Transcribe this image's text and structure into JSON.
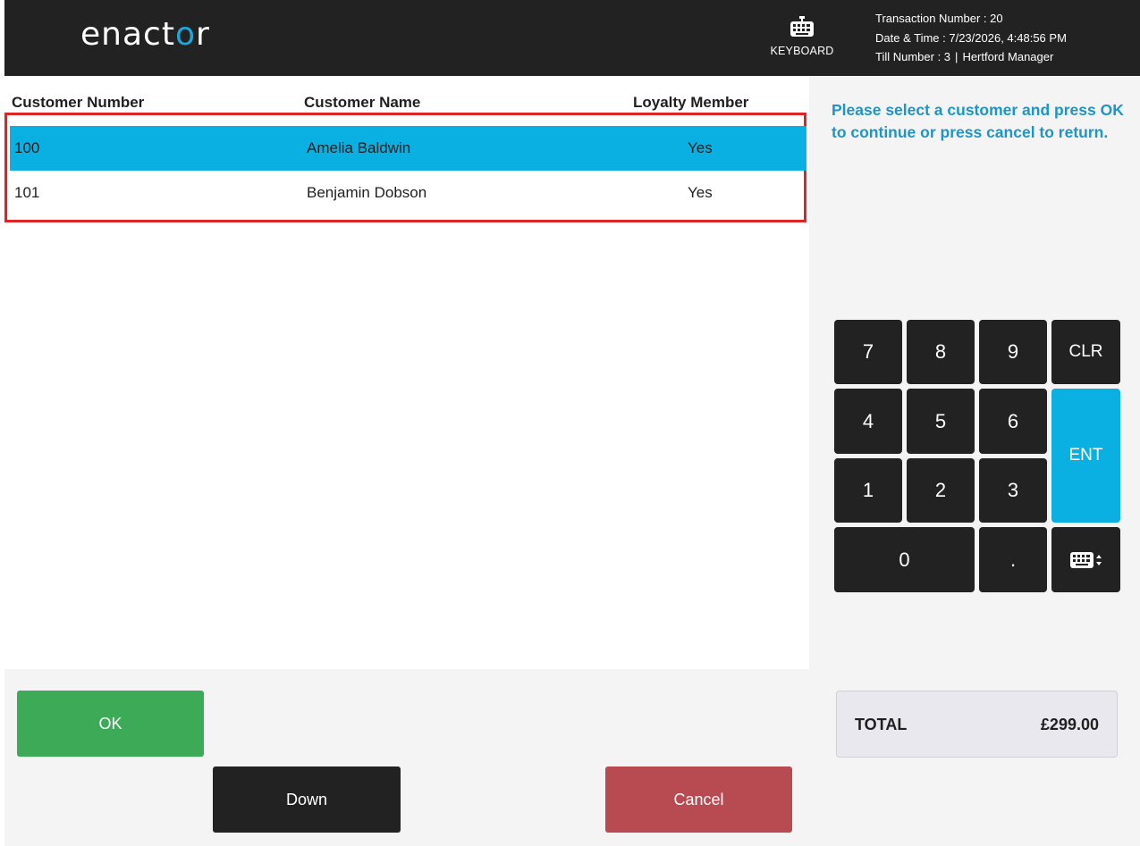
{
  "header": {
    "logo_text_left": "enact",
    "logo_text_mark": "o",
    "logo_text_right": "r",
    "keyboard_label": "KEYBOARD",
    "transaction_number": "Transaction Number : 20",
    "date_time": "Date & Time : 7/23/2026, 4:48:56 PM",
    "till_number": "Till Number : 3",
    "separator": "|",
    "user": "Hertford Manager"
  },
  "table": {
    "columns": [
      "Customer Number",
      "Customer Name",
      "Loyalty Member"
    ],
    "rows": [
      {
        "number": "100",
        "name": "Amelia Baldwin",
        "loyalty": "Yes",
        "selected": true
      },
      {
        "number": "101",
        "name": "Benjamin Dobson",
        "loyalty": "Yes",
        "selected": false
      }
    ]
  },
  "prompt": "Please select a customer and press OK to continue or press cancel to return.",
  "keypad": {
    "k7": "7",
    "k8": "8",
    "k9": "9",
    "clr": "CLR",
    "k4": "4",
    "k5": "5",
    "k6": "6",
    "ent": "ENT",
    "k1": "1",
    "k2": "2",
    "k3": "3",
    "k0": "0",
    "dot": "."
  },
  "buttons": {
    "ok": "OK",
    "down": "Down",
    "cancel": "Cancel"
  },
  "total": {
    "label": "TOTAL",
    "value": "£299.00"
  },
  "colors": {
    "header_bg": "#222222",
    "accent_blue": "#0ab0e2",
    "ok_green": "#3daa58",
    "cancel_red": "#b84a52",
    "selection_border": "#e02424"
  }
}
